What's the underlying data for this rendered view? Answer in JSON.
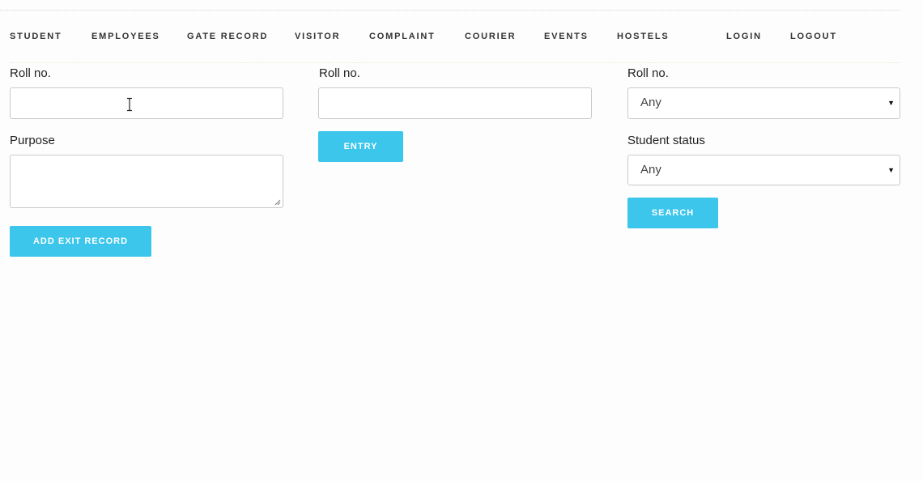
{
  "nav": {
    "items": [
      {
        "label": "STUDENT"
      },
      {
        "label": "EMPLOYEES"
      },
      {
        "label": "GATE RECORD"
      },
      {
        "label": "VISITOR"
      },
      {
        "label": "COMPLAINT"
      },
      {
        "label": "COURIER"
      },
      {
        "label": "EVENTS"
      },
      {
        "label": "HOSTELS"
      },
      {
        "label": "LOGIN"
      },
      {
        "label": "LOGOUT"
      }
    ]
  },
  "exit_form": {
    "roll_label": "Roll no.",
    "roll_value": "",
    "purpose_label": "Purpose",
    "purpose_value": "",
    "submit_label": "ADD EXIT RECORD"
  },
  "entry_form": {
    "roll_label": "Roll no.",
    "roll_value": "",
    "submit_label": "ENTRY"
  },
  "search_form": {
    "roll_label": "Roll no.",
    "roll_selected": "Any",
    "status_label": "Student status",
    "status_selected": "Any",
    "submit_label": "SEARCH"
  },
  "theme": {
    "accent": "#3cc6ec",
    "border": "#c9c9c9",
    "background": "#fdfdfd"
  }
}
